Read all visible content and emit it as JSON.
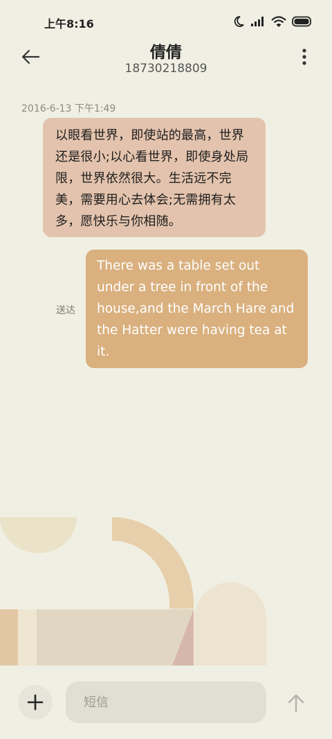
{
  "status_bar": {
    "time": "上午8:16",
    "icons": [
      "moon-icon",
      "signal-icon",
      "wifi-icon",
      "battery-icon"
    ]
  },
  "header": {
    "back_icon": "back-arrow-icon",
    "contact_name": "倩倩",
    "phone_number": "18730218809",
    "more_icon": "more-vert-icon"
  },
  "conversation": {
    "timestamp": "2016-6-13 下午1:49",
    "messages": [
      {
        "direction": "incoming",
        "text": "以眼看世界，即使站的最高，世界还是很小;以心看世界，即使身处局限，世界依然很大。生活远不完美，需要用心去体会;无需拥有太多，愿快乐与你相随。"
      },
      {
        "direction": "outgoing",
        "text": "There was a table set out under a tree in front of the house,and the March Hare and the Hatter were having tea at it.",
        "status": "送达"
      }
    ]
  },
  "composer": {
    "add_icon": "plus-icon",
    "placeholder": "短信",
    "send_icon": "send-arrow-up-icon"
  },
  "colors": {
    "background": "#F0EFE3",
    "incoming_bubble": "#E3C3AD",
    "outgoing_bubble": "#D9B07E"
  }
}
